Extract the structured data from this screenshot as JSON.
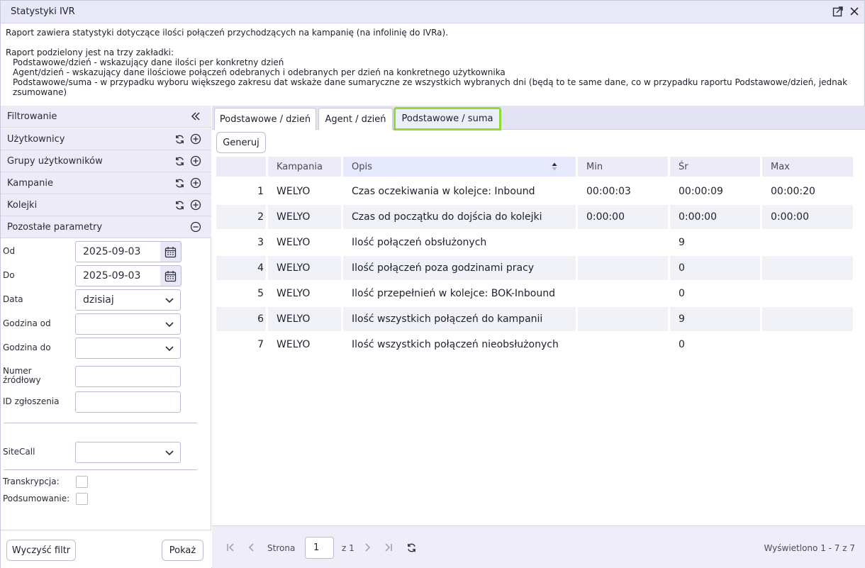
{
  "window": {
    "title": "Statystyki IVR",
    "icons": [
      "external-link-icon",
      "close-icon"
    ]
  },
  "description": {
    "line1": "Raport zawiera statystyki dotyczące ilości połączeń przychodzących na kampanię (na infolinię do IVRa).",
    "line2": "Raport podzielony jest na trzy zakładki:",
    "line3": "Podstawowe/dzień - wskazujący dane ilości per konkretny dzień",
    "line4": "Agent/dzień - wskazujący dane ilościowe połączeń odebranych i odebranych per dzień na konkretnego użytkownika",
    "line5": "Podstawowe/suma - w przypadku wyboru większego zakresu dat wskaże dane sumaryczne ze wszystkich wybranych dni (będą to te same dane, co w przypadku raportu Podstawowe/dzień, jednak",
    "line6": "zsumowane)"
  },
  "filter": {
    "header": "Filtrowanie",
    "sections": [
      {
        "label": "Użytkownicy"
      },
      {
        "label": "Grupy użytkowników"
      },
      {
        "label": "Kampanie"
      },
      {
        "label": "Kolejki"
      },
      {
        "label": "Pozostałe parametry"
      }
    ],
    "fields": {
      "od_label": "Od",
      "od_value": "2025-09-03",
      "do_label": "Do",
      "do_value": "2025-09-03",
      "data_label": "Data",
      "data_value": "dzisiaj",
      "godzina_od_label": "Godzina od",
      "godzina_od_value": "",
      "godzina_do_label": "Godzina do",
      "godzina_do_value": "",
      "numer_label_1": "Numer",
      "numer_label_2": "źródłowy",
      "numer_value": "",
      "id_label": "ID zgłoszenia",
      "id_value": "",
      "sitecall_label": "SiteCall",
      "sitecall_value": "",
      "transkrypcja_label": "Transkrypcja:",
      "podsumowanie_label": "Podsumowanie:"
    },
    "clear_button": "Wyczyść filtr",
    "show_button": "Pokaż"
  },
  "tabs": [
    {
      "label": "Podstawowe / dzień"
    },
    {
      "label": "Agent / dzień"
    },
    {
      "label": "Podstawowe / suma"
    }
  ],
  "active_tab": "Podstawowe / suma",
  "generate_button": "Generuj",
  "table": {
    "columns": [
      "",
      "Kampania",
      "Opis",
      "Min",
      "Śr",
      "Max"
    ],
    "rows": [
      [
        "1",
        "WELYO",
        "Czas oczekiwania w kolejce: Inbound",
        "00:00:03",
        "00:00:09",
        "00:00:20"
      ],
      [
        "2",
        "WELYO",
        "Czas od początku do dojścia do kolejki",
        "0:00:00",
        "0:00:00",
        "0:00:00"
      ],
      [
        "3",
        "WELYO",
        "Ilość połączeń obsłużonych",
        "",
        "9",
        ""
      ],
      [
        "4",
        "WELYO",
        "Ilość połączeń poza godzinami pracy",
        "",
        "0",
        ""
      ],
      [
        "5",
        "WELYO",
        "Ilość przepełnień w kolejce: BOK-Inbound",
        "",
        "0",
        ""
      ],
      [
        "6",
        "WELYO",
        "Ilość wszystkich połączeń do kampanii",
        "",
        "9",
        ""
      ],
      [
        "7",
        "WELYO",
        "Ilość wszystkich połączeń nieobsłużonych",
        "",
        "0",
        ""
      ]
    ]
  },
  "pagination": {
    "page_label": "Strona",
    "page_value": "1",
    "of_label": "z 1",
    "summary": "Wyświetlono 1 - 7 z 7"
  },
  "colors": {
    "active_tab_border": "#8edc32",
    "panel_bg": "#ecebf7"
  }
}
